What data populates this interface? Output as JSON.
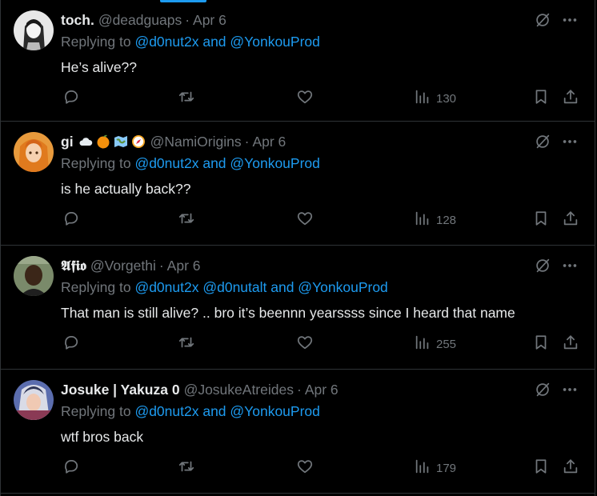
{
  "tweets": [
    {
      "name": "toch.",
      "emojis": [],
      "handle": "@deadguaps",
      "date": "Apr 6",
      "reply_prefix": "Replying to",
      "mentions": "@d0nut2x and @YonkouProd",
      "text": "He’s alive??",
      "views": "130"
    },
    {
      "name": "gi",
      "emojis": [
        "cloud-emoji",
        "orange-emoji",
        "map-emoji",
        "compass-emoji"
      ],
      "handle": "@NamiOrigins",
      "date": "Apr 6",
      "reply_prefix": "Replying to",
      "mentions": "@d0nut2x and @YonkouProd",
      "text": "is he actually back??",
      "views": "128"
    },
    {
      "name": "𝕬𝖋𝖎𝖔",
      "emojis": [],
      "handle": "@Vorgethi",
      "date": "Apr 6",
      "reply_prefix": "Replying to",
      "mentions": "@d0nut2x @d0nutalt and @YonkouProd",
      "text": "That man is still alive? .. bro it’s beennn yearssss since I heard that name",
      "views": "255"
    },
    {
      "name": "Josuke | Yakuza 0",
      "emojis": [],
      "handle": "@JosukeAtreides",
      "date": "Apr 6",
      "reply_prefix": "Replying to",
      "mentions": "@d0nut2x and @YonkouProd",
      "text": "wtf bros back",
      "views": "179"
    }
  ],
  "colors": {
    "background": "#000000",
    "text": "#e7e9ea",
    "muted": "#71767b",
    "link": "#1d9bf0",
    "border": "#2f3336"
  },
  "icons": {
    "reply": "reply-icon",
    "repost": "repost-icon",
    "like": "like-icon",
    "views": "views-icon",
    "bookmark": "bookmark-icon",
    "share": "share-icon",
    "grok": "grok-icon",
    "more": "more-icon"
  }
}
